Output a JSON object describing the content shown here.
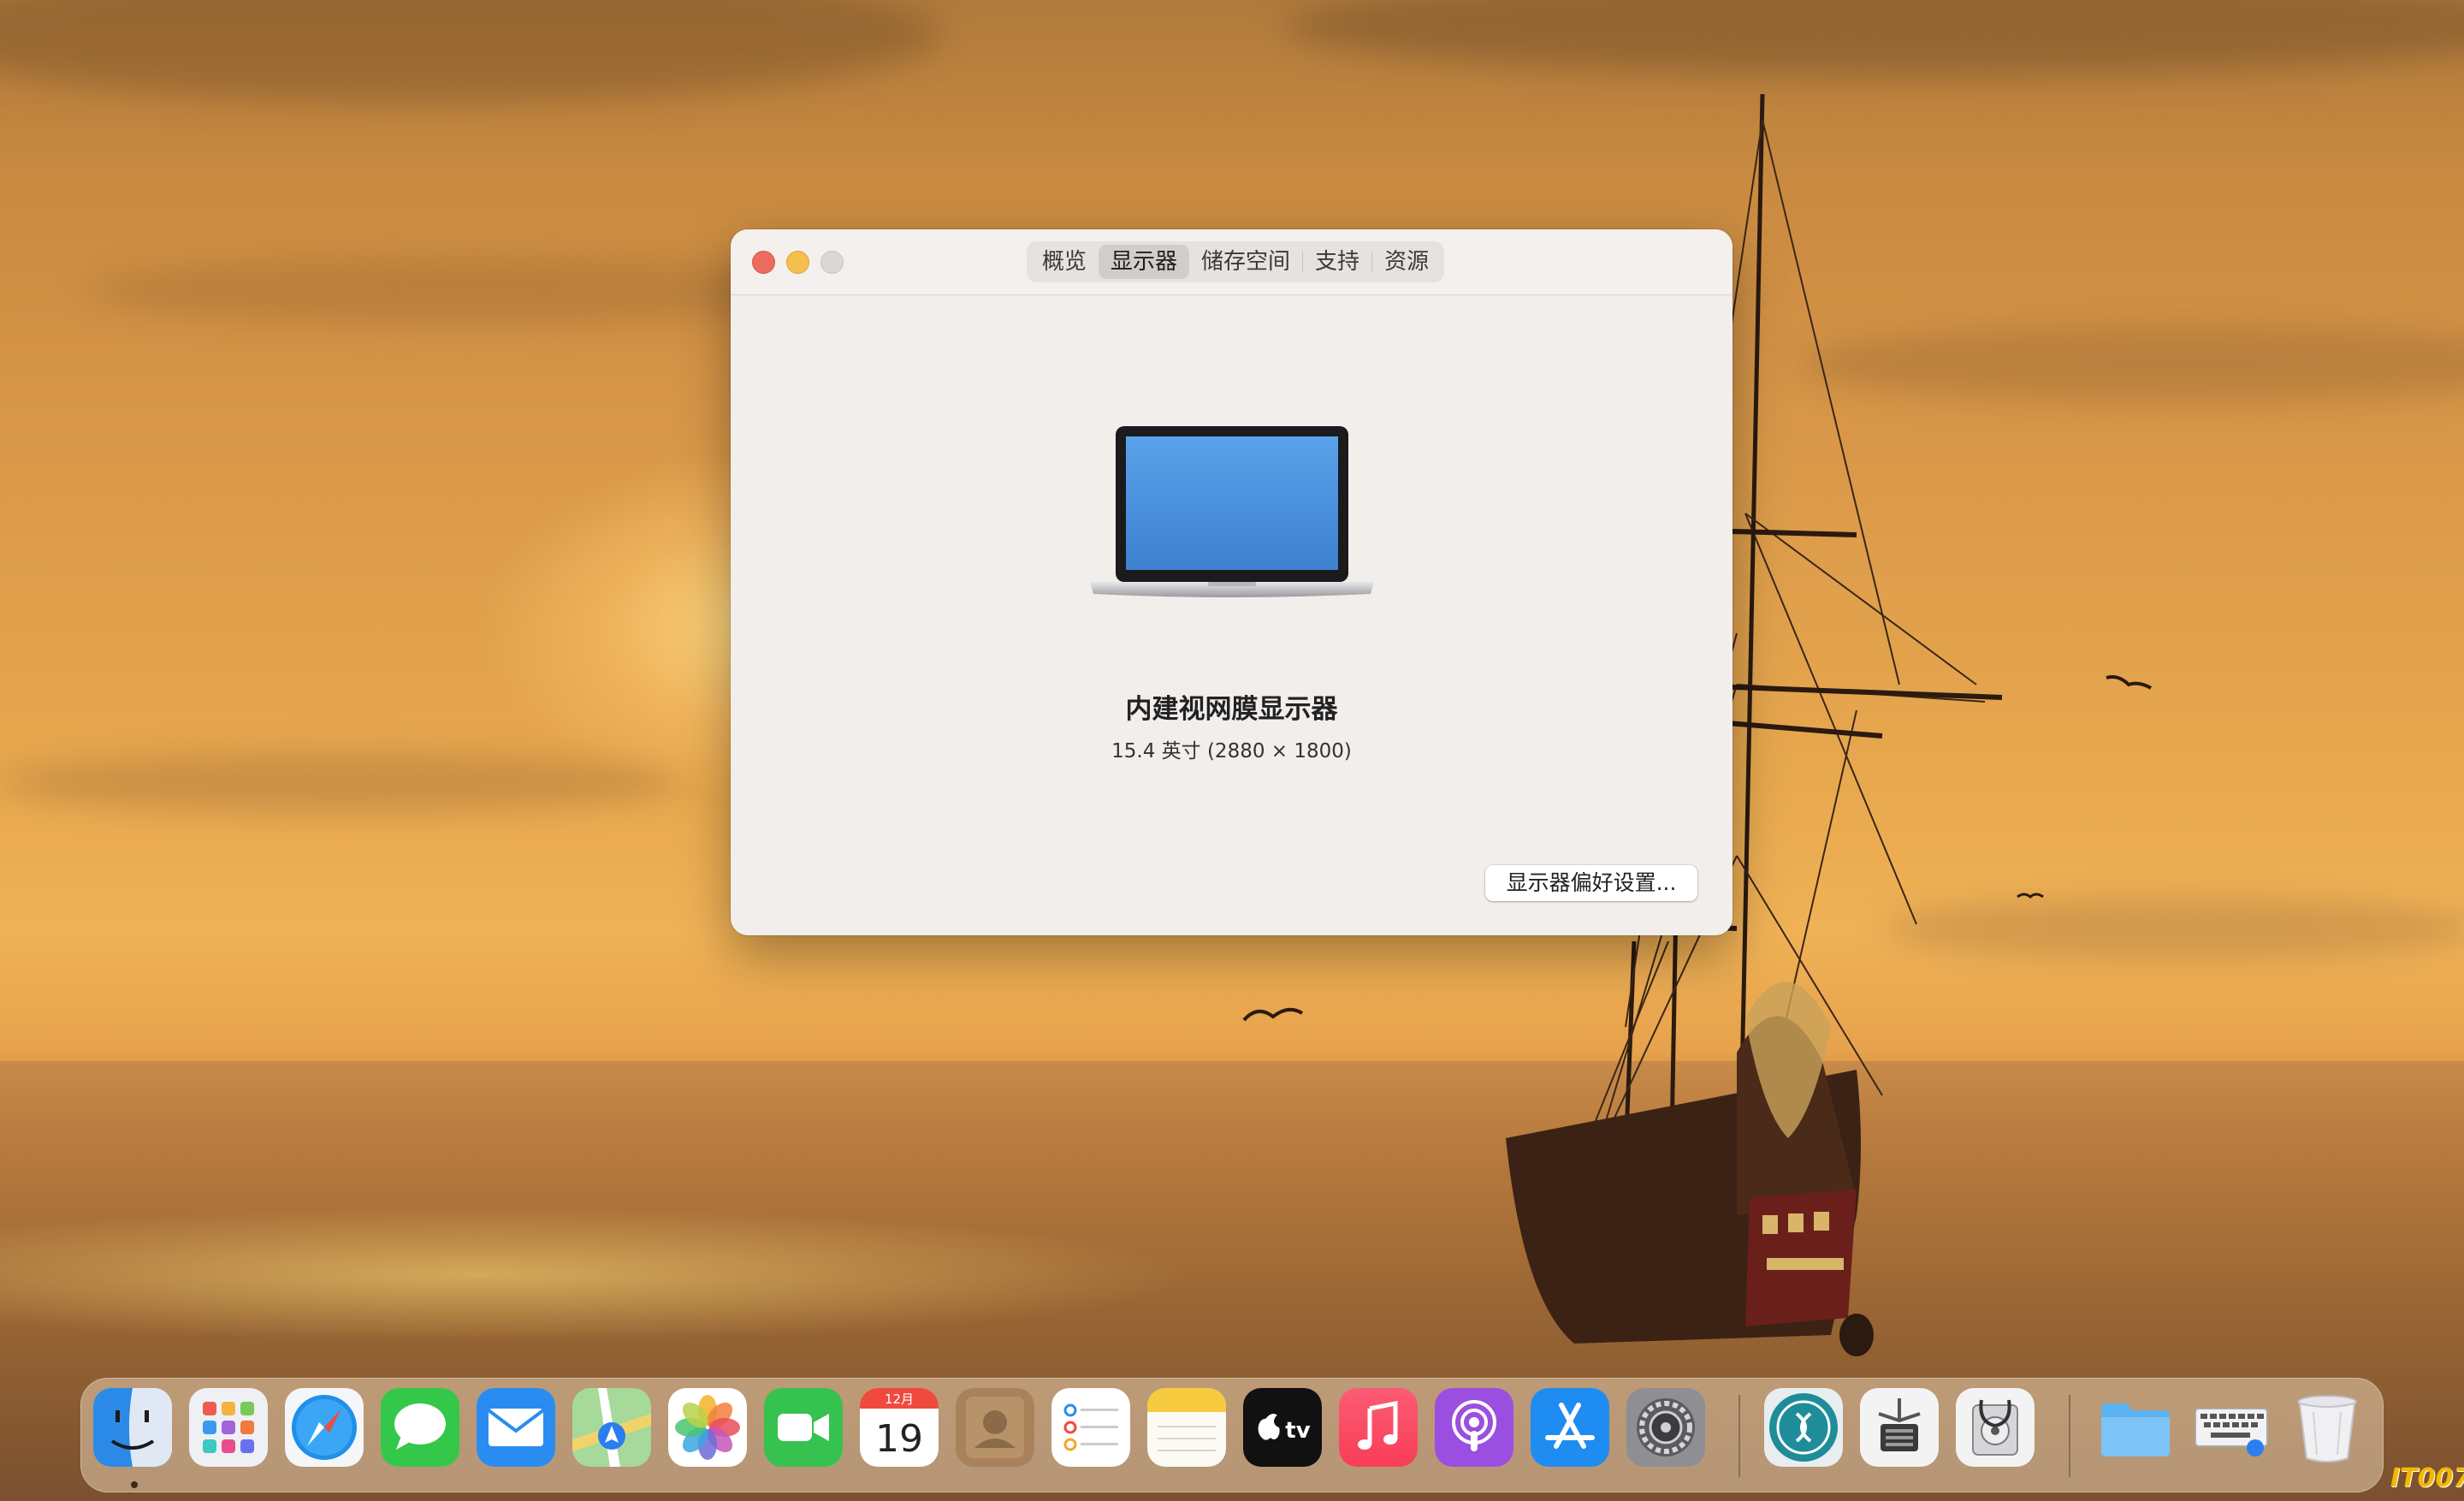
{
  "window": {
    "tabs": [
      {
        "label": "概览",
        "active": false
      },
      {
        "label": "显示器",
        "active": true
      },
      {
        "label": "储存空间",
        "active": false
      },
      {
        "label": "支持",
        "active": false
      },
      {
        "label": "资源",
        "active": false
      }
    ],
    "display_name": "内建视网膜显示器",
    "display_spec": "15.4 英寸 (2880 × 1800)",
    "prefs_button_label": "显示器偏好设置..."
  },
  "dock": {
    "apps": [
      "finder-icon",
      "launchpad-icon",
      "safari-icon",
      "messages-icon",
      "mail-icon",
      "maps-icon",
      "photos-icon",
      "facetime-icon",
      "calendar-icon",
      "contacts-icon",
      "reminders-icon",
      "notes-icon",
      "apple-tv-icon",
      "music-icon",
      "podcasts-icon",
      "app-store-icon",
      "system-preferences-icon",
      "app-icon",
      "utility-app-icon",
      "disk-utility-icon",
      "downloads-folder-icon",
      "keyboard-viewer-icon",
      "trash-icon"
    ],
    "calendar": {
      "month": "12月",
      "day": "19"
    },
    "tv_label": "tv"
  },
  "watermark": "IT007",
  "colors": {
    "close": "#ed6a5e",
    "minimize": "#f5bf4f",
    "accent": "#3478f6"
  }
}
